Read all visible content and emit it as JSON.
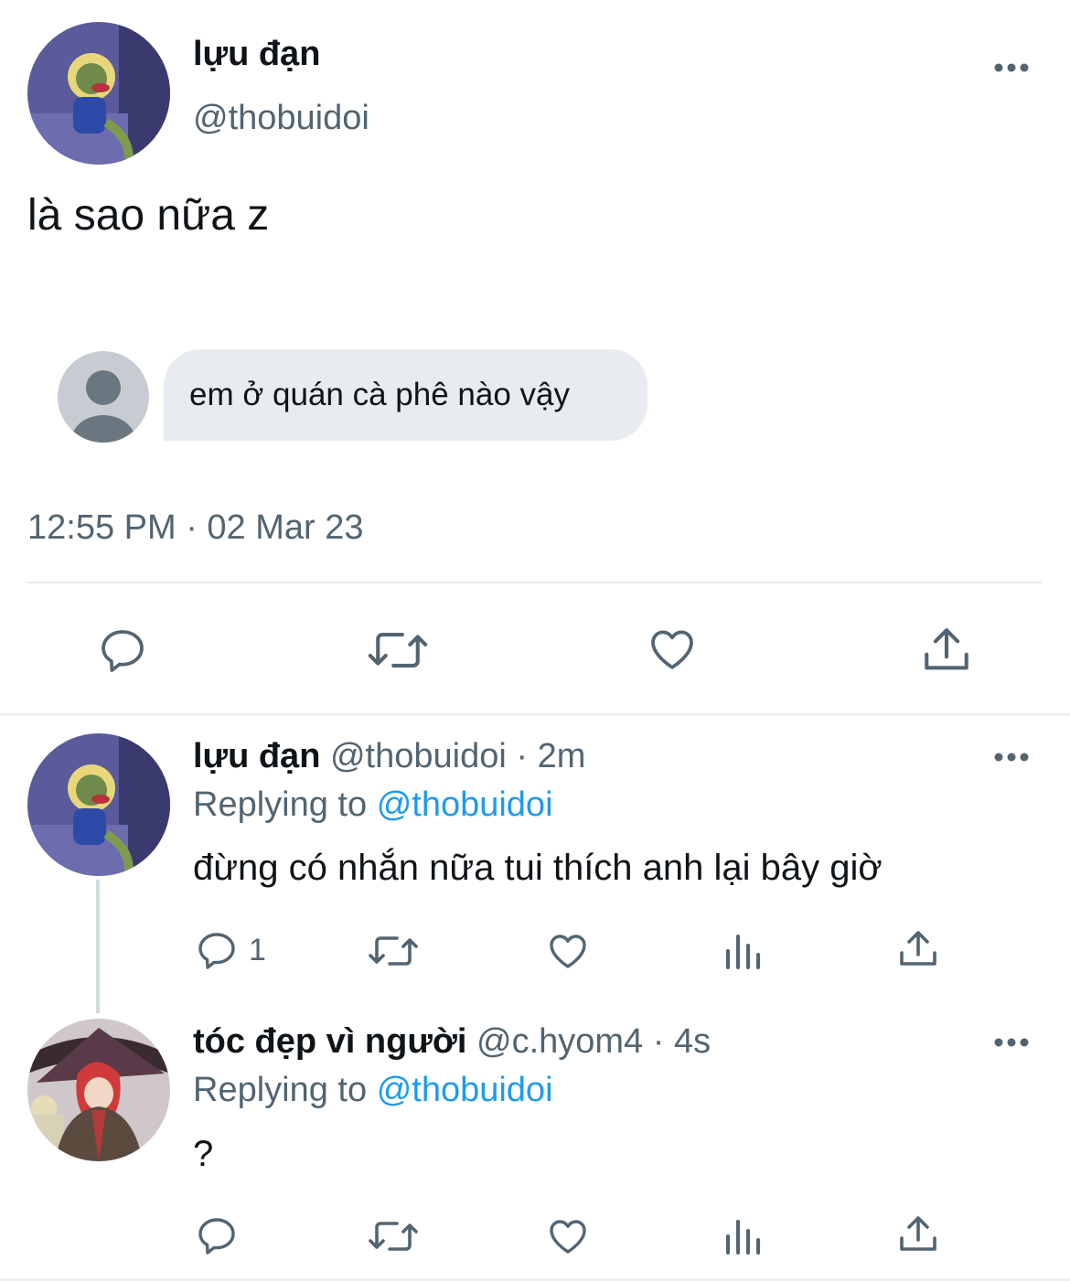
{
  "main_tweet": {
    "display_name": "lựu đạn",
    "handle": "@thobuidoi",
    "text": "là sao nữa z",
    "quoted_message": "em ở quán cà phê nào vậy",
    "timestamp": "12:55 PM · 02 Mar 23"
  },
  "replies": [
    {
      "display_name": "lựu đạn",
      "handle": "@thobuidoi",
      "time": "· 2m",
      "replying_prefix": "Replying to",
      "replying_to": "@thobuidoi",
      "text": "đừng có nhắn nữa tui thích anh lại bây giờ",
      "reply_count": "1"
    },
    {
      "display_name": "tóc đẹp vì người",
      "handle": "@c.hyom4",
      "time": "· 4s",
      "replying_prefix": "Replying to",
      "replying_to": "@thobuidoi",
      "text": "?",
      "reply_count": ""
    }
  ],
  "icons": {
    "more": "more-icon",
    "reply": "reply-icon",
    "retweet": "retweet-icon",
    "like": "like-icon",
    "views": "views-icon",
    "share": "share-icon"
  },
  "colors": {
    "text": "#0f1419",
    "secondary": "#536471",
    "accent": "#1d9bf0",
    "bubble": "#e8ecf0",
    "divider": "#e6e9ec"
  }
}
